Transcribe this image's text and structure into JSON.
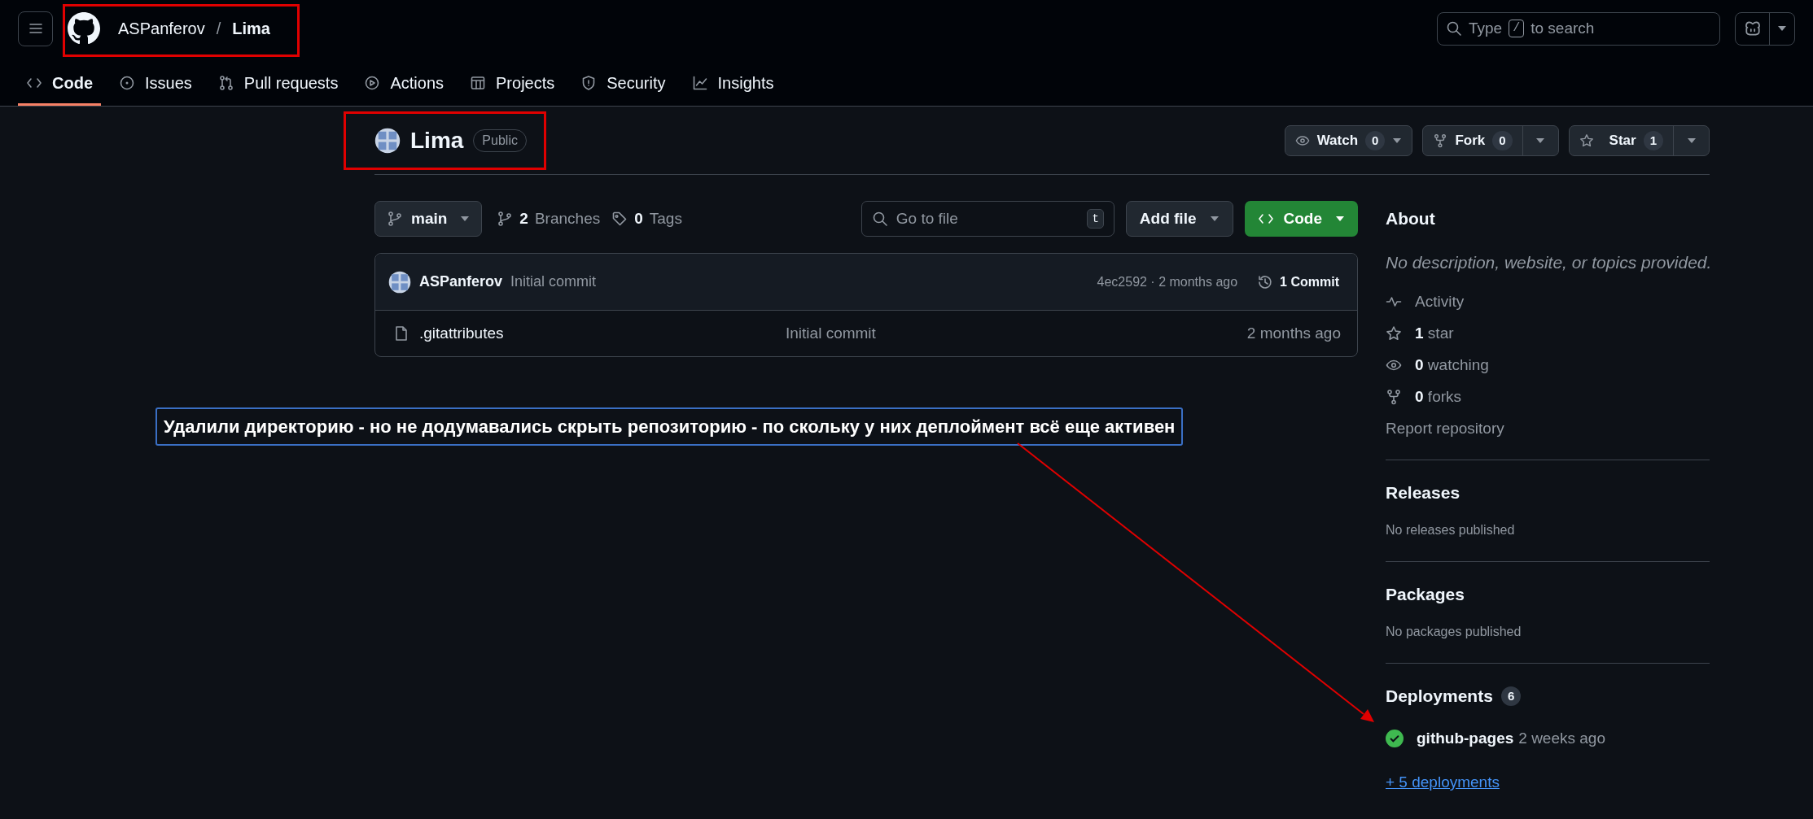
{
  "header": {
    "owner": "ASPanferov",
    "separator": "/",
    "repo": "Lima",
    "search": {
      "placeholder_before": "Type",
      "key": "/",
      "placeholder_after": "to search"
    }
  },
  "nav_tabs": [
    {
      "kind": "code",
      "label": "Code",
      "selected": true
    },
    {
      "kind": "issues",
      "label": "Issues",
      "selected": false
    },
    {
      "kind": "pulls",
      "label": "Pull requests",
      "selected": false
    },
    {
      "kind": "actions",
      "label": "Actions",
      "selected": false
    },
    {
      "kind": "projects",
      "label": "Projects",
      "selected": false
    },
    {
      "kind": "security",
      "label": "Security",
      "selected": false
    },
    {
      "kind": "insights",
      "label": "Insights",
      "selected": false
    }
  ],
  "repo": {
    "name": "Lima",
    "visibility": "Public",
    "actions": [
      {
        "kind": "watch",
        "label": "Watch",
        "count": "0"
      },
      {
        "kind": "fork",
        "label": "Fork",
        "count": "0"
      },
      {
        "kind": "star",
        "label": "Star",
        "count": "1"
      }
    ]
  },
  "toolbar": {
    "branch": "main",
    "branches_count": "2",
    "branches_label": "Branches",
    "tags_count": "0",
    "tags_label": "Tags",
    "file_search": {
      "placeholder": "Go to file",
      "shortcut": "t"
    },
    "add_file": "Add file",
    "code": "Code"
  },
  "latest_commit": {
    "author": "ASPanferov",
    "message": "Initial commit",
    "meta": "4ec2592 · 2 months ago",
    "commits": "1 Commit"
  },
  "files": [
    {
      "name": ".gitattributes",
      "message": "Initial commit",
      "time": "2 months ago"
    }
  ],
  "about": {
    "title": "About",
    "description": "No description, website, or topics provided.",
    "stats": [
      {
        "kind": "activity",
        "text": "Activity"
      },
      {
        "kind": "star",
        "text": "**1** star"
      },
      {
        "kind": "watching",
        "text": "**0** watching"
      },
      {
        "kind": "forks",
        "text": "**0** forks"
      }
    ],
    "report": "Report repository"
  },
  "releases": {
    "title": "Releases",
    "text": "No releases published"
  },
  "packages": {
    "title": "Packages",
    "text": "No packages published"
  },
  "deployments": {
    "title": "Deployments",
    "count": "6",
    "items": [
      {
        "name": "github-pages",
        "time": "2 weeks ago",
        "succeeded": true
      }
    ],
    "more": "+ 5 deployments"
  },
  "annotation": {
    "text": "Удалили директорию - но не додумавались скрыть репозиторию - по скольку у них деплоймент всё еще активен"
  }
}
